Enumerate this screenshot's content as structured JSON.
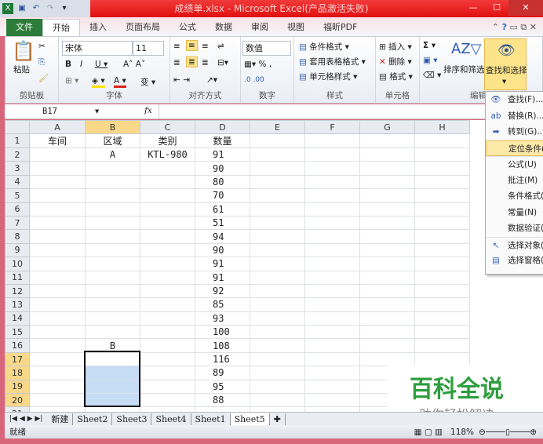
{
  "title": "成绩单.xlsx - Microsoft Excel(产品激活失败)",
  "window_buttons": [
    "—",
    "☐",
    "✕"
  ],
  "tabs": [
    "文件",
    "开始",
    "插入",
    "页面布局",
    "公式",
    "数据",
    "审阅",
    "视图",
    "福昕PDF"
  ],
  "ribbon": {
    "clipboard": {
      "label": "剪贴板",
      "paste": "粘贴"
    },
    "font": {
      "label": "字体",
      "font_name": "宋体",
      "font_size": "11"
    },
    "alignment": {
      "label": "对齐方式"
    },
    "number": {
      "label": "数字",
      "format": "数值"
    },
    "styles": {
      "label": "样式",
      "items": [
        "条件格式 ▾",
        "套用表格格式 ▾",
        "单元格样式 ▾"
      ]
    },
    "cells": {
      "label": "单元格",
      "items": [
        "插入 ▾",
        "删除 ▾",
        "格式 ▾"
      ]
    },
    "editing": {
      "label": "编辑",
      "sort": "排序和筛选",
      "find": "查找和选择"
    }
  },
  "formula_bar": {
    "name_box": "B17",
    "fx": "fx",
    "value": ""
  },
  "columns": [
    "A",
    "B",
    "C",
    "D",
    "E",
    "F",
    "G",
    "H"
  ],
  "rows": [
    [
      "车间",
      "区域",
      "类别",
      "数量"
    ],
    [
      "",
      "A",
      "KTL-980",
      "91"
    ],
    [
      "",
      "",
      "",
      "90"
    ],
    [
      "",
      "",
      "",
      "80"
    ],
    [
      "",
      "",
      "",
      "70"
    ],
    [
      "",
      "",
      "",
      "61"
    ],
    [
      "",
      "",
      "",
      "51"
    ],
    [
      "",
      "",
      "",
      "94"
    ],
    [
      "",
      "",
      "",
      "90"
    ],
    [
      "",
      "",
      "",
      "91"
    ],
    [
      "",
      "",
      "",
      "91"
    ],
    [
      "",
      "",
      "",
      "92"
    ],
    [
      "",
      "",
      "",
      "85"
    ],
    [
      "",
      "",
      "",
      "93"
    ],
    [
      "",
      "",
      "",
      "100"
    ],
    [
      "",
      "B",
      "",
      "108"
    ],
    [
      "",
      "",
      "",
      "116"
    ],
    [
      "",
      "",
      "",
      "89"
    ],
    [
      "",
      "",
      "",
      "95"
    ],
    [
      "",
      "",
      "",
      "88"
    ],
    [
      "",
      "",
      "",
      ""
    ]
  ],
  "selection": {
    "active_cell": "B17",
    "range": "B17:B20"
  },
  "menu": [
    "查找(F)...",
    "替换(R)...",
    "转到(G)...",
    "定位条件(S)...",
    "公式(U)",
    "批注(M)",
    "条件格式(C)",
    "常量(N)",
    "数据验证(V)",
    "选择对象(O)",
    "选择窗格(P)"
  ],
  "menu_highlighted": "定位条件(S)...",
  "sheets": [
    "新建",
    "Sheet2",
    "Sheet3",
    "Sheet4",
    "Sheet1",
    "Sheet5"
  ],
  "active_sheet": "Sheet5",
  "status": {
    "ready": "就绪",
    "zoom": "118%"
  },
  "watermark": {
    "title": "百科全说",
    "subtitle": "助你轻松解决"
  },
  "colors": {
    "title_bar": "#e01010",
    "file_tab": "#2d7d3a",
    "selection": "#c6dcf5",
    "highlight": "#fde48a",
    "watermark": "#2e9e3e"
  }
}
